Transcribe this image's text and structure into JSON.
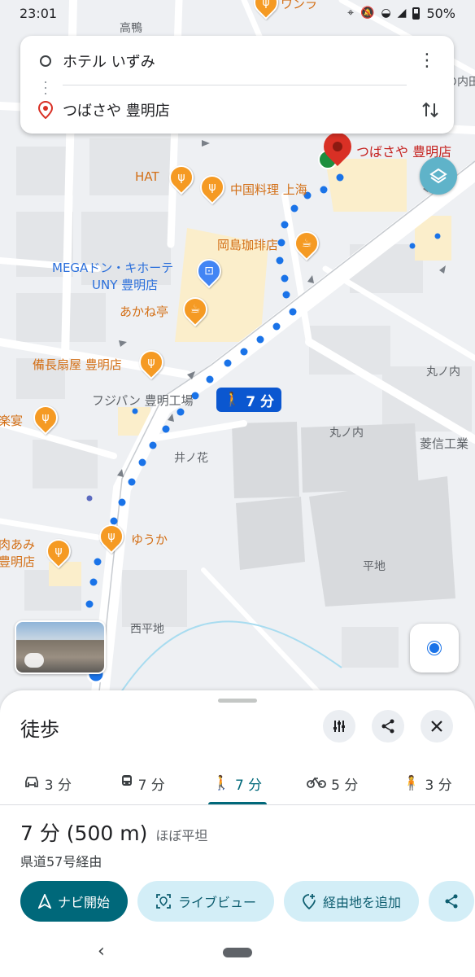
{
  "status_bar": {
    "time": "23:01",
    "battery": "50%"
  },
  "route_card": {
    "origin": "ホテル いずみ",
    "destination": "つばさや 豊明店"
  },
  "map": {
    "labels": {
      "takashima": "高鴨",
      "destination_label": "つばさや 豊明店",
      "hat": "HAT",
      "chinese": "中国料理 上海",
      "okajima": "岡島珈琲店",
      "mega": "MEGAドン・キホーテ",
      "uny": "UNY 豊明店",
      "akane": "あかね亭",
      "binchou": "備長扇屋 豊明店",
      "fujipan": "フジパン 豊明工場",
      "rakuen": "楽宴",
      "inohana": "井ノ花",
      "marunouchi1": "丸ノ内",
      "marunouchi2": "丸ノ内",
      "ryoshin": "菱信工業",
      "yuuka": "ゆうか",
      "nikuami1": "肉あみ",
      "nikuami2": "豊明店",
      "heichi": "平地",
      "nishiheichi": "西平地",
      "top_right": "の内田",
      "top_poi": "ワンラ"
    },
    "walk_badge": "7 分",
    "accent_color": "#1a73e8"
  },
  "sheet": {
    "title": "徒歩",
    "tabs": [
      {
        "icon": "car-icon",
        "label": "3 分",
        "active": false
      },
      {
        "icon": "train-icon",
        "label": "7 分",
        "active": false
      },
      {
        "icon": "walk-icon",
        "label": "7 分",
        "active": true
      },
      {
        "icon": "bike-icon",
        "label": "5 分",
        "active": false
      },
      {
        "icon": "ride-icon",
        "label": "3 分",
        "active": false
      }
    ],
    "duration": "7 分 (500 m)",
    "terrain": "ほぼ平坦",
    "via": "県道57号経由",
    "buttons": {
      "start": "ナビ開始",
      "live_view": "ライブビュー",
      "add_stop": "経由地を追加"
    }
  }
}
